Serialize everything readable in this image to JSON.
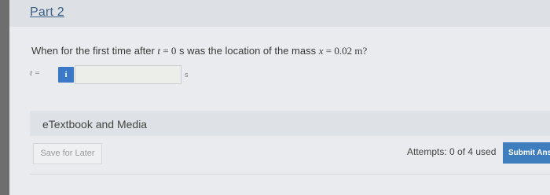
{
  "part": {
    "title": "Part 2"
  },
  "question": {
    "text_before": "When for the first time after ",
    "var_t": "t",
    "eq_zero": " = 0",
    "text_middle": " s was the location of the mass ",
    "var_x": "x",
    "eq_value": " = 0.02 m?"
  },
  "answer": {
    "variable_label": "t  =",
    "info_symbol": "i",
    "value": "",
    "unit": "s"
  },
  "etextbook": {
    "label": "eTextbook and Media"
  },
  "footer": {
    "save_label": "Save for Later",
    "attempts_label": "Attempts: 0 of 4 used",
    "submit_label": "Submit Ans"
  },
  "colors": {
    "accent": "#3f7ebe",
    "link": "#3c5f86"
  }
}
